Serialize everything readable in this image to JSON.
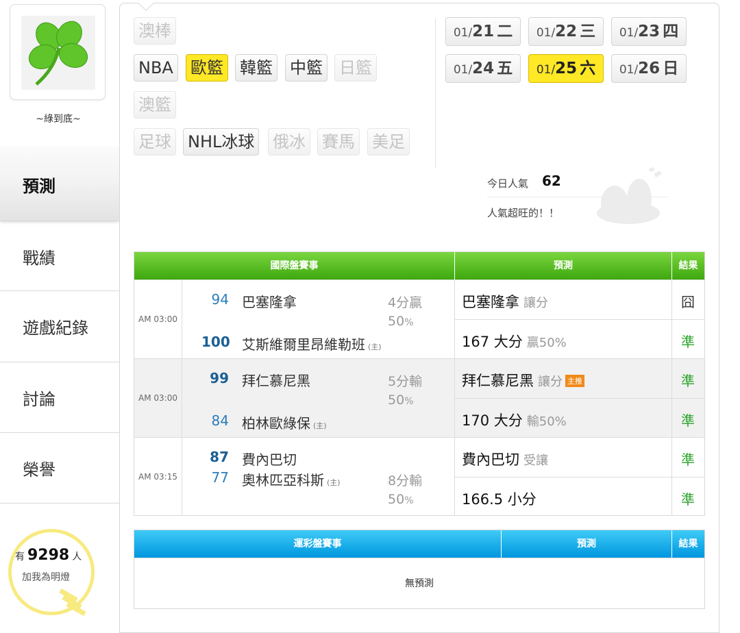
{
  "sidebar": {
    "nickname": "~綠到底~",
    "menu": [
      {
        "label": "預測",
        "active": true
      },
      {
        "label": "戰績"
      },
      {
        "label": "遊戲紀錄"
      },
      {
        "label": "討論"
      },
      {
        "label": "榮譽"
      }
    ],
    "fans": {
      "prefix": "有",
      "count": "9298",
      "suffix": "人",
      "line2": "加我為明燈"
    }
  },
  "sport_tags": [
    {
      "label": "澳棒",
      "state": "disabled"
    },
    {
      "label": "NBA",
      "state": "normal"
    },
    {
      "label": "歐籃",
      "state": "selected"
    },
    {
      "label": "韓籃",
      "state": "normal"
    },
    {
      "label": "中籃",
      "state": "normal"
    },
    {
      "label": "日籃",
      "state": "disabled"
    },
    {
      "label": "澳籃",
      "state": "disabled"
    },
    {
      "label": "足球",
      "state": "disabled"
    },
    {
      "label": "NHL冰球",
      "state": "normal"
    },
    {
      "label": "俄冰",
      "state": "disabled"
    },
    {
      "label": "賽馬",
      "state": "disabled"
    },
    {
      "label": "美足",
      "state": "disabled"
    }
  ],
  "dates": [
    {
      "month": "01/",
      "day": "21",
      "weekday": "二"
    },
    {
      "month": "01/",
      "day": "22",
      "weekday": "三"
    },
    {
      "month": "01/",
      "day": "23",
      "weekday": "四"
    },
    {
      "month": "01/",
      "day": "24",
      "weekday": "五"
    },
    {
      "month": "01/",
      "day": "25",
      "weekday": "六",
      "selected": true
    },
    {
      "month": "01/",
      "day": "26",
      "weekday": "日"
    }
  ],
  "popularity": {
    "label": "今日人氣",
    "count": "62",
    "message": "人氣超旺的！！"
  },
  "intl_table": {
    "headers": {
      "events": "國際盤賽事",
      "prediction": "預測",
      "result": "結果"
    },
    "matches": [
      {
        "time": "AM 03:00",
        "away": {
          "score": "94",
          "name": "巴塞隆拿"
        },
        "home": {
          "score": "100",
          "name": "艾斯維爾里昂維勒班",
          "tag": "(主)"
        },
        "handicap": {
          "line": "4分贏",
          "pct": "50",
          "pct_unit": "%"
        },
        "predictions": [
          {
            "pick": "巴塞隆拿",
            "sub": "讓分",
            "result": "囧",
            "result_type": "lose"
          },
          {
            "pick": "167 大分",
            "sub": "贏50%",
            "result": "準",
            "result_type": "win"
          }
        ]
      },
      {
        "time": "AM 03:00",
        "away": {
          "score": "99",
          "name": "拜仁慕尼黑"
        },
        "home": {
          "score": "84",
          "name": "柏林歐綠保",
          "tag": "(主)"
        },
        "handicap": {
          "line": "5分輸",
          "pct": "50",
          "pct_unit": "%"
        },
        "predictions": [
          {
            "pick": "拜仁慕尼黑",
            "sub": "讓分",
            "badge": "主推",
            "result": "準",
            "result_type": "win"
          },
          {
            "pick": "170 大分",
            "sub": "輸50%",
            "result": "準",
            "result_type": "win"
          }
        ]
      },
      {
        "time": "AM 03:15",
        "away": {
          "score": "87",
          "name": "費內巴切"
        },
        "home": {
          "score": "77",
          "name": "奧林匹亞科斯",
          "tag": "(主)"
        },
        "handicap": {
          "line": "8分輸",
          "pct": "50",
          "pct_unit": "%"
        },
        "predictions": [
          {
            "pick": "費內巴切",
            "sub": "受讓",
            "result": "準",
            "result_type": "win"
          },
          {
            "pick": "166.5 小分",
            "sub": "",
            "result": "準",
            "result_type": "win"
          }
        ]
      }
    ]
  },
  "lottery_table": {
    "headers": {
      "events": "運彩盤賽事",
      "prediction": "預測",
      "result": "結果"
    },
    "empty_message": "無預測"
  }
}
